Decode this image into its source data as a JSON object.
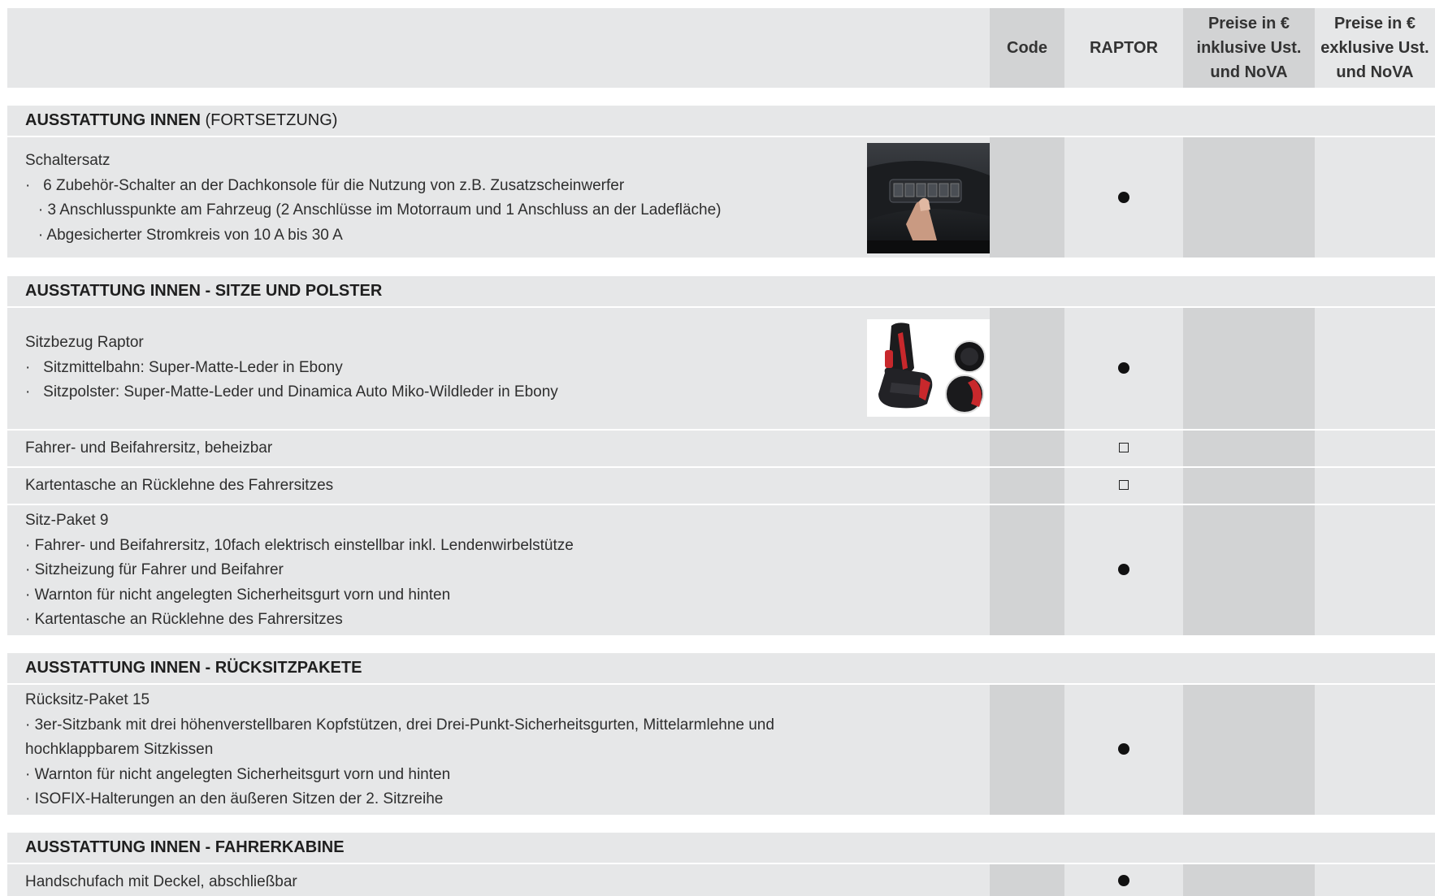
{
  "header": {
    "code": "Code",
    "raptor": "RAPTOR",
    "price_incl_lines": [
      "Preise in €",
      "inklusive Ust.",
      "und NoVA"
    ],
    "price_excl_lines": [
      "Preise in €",
      "exklusive Ust.",
      "und NoVA"
    ]
  },
  "sections": {
    "s1": {
      "title_bold": "AUSSTATTUNG INNEN",
      "title_normal": " (FORTSETZUNG)"
    },
    "s2": {
      "title_bold": "AUSSTATTUNG INNEN - SITZE UND POLSTER"
    },
    "s3": {
      "title_bold": "AUSSTATTUNG INNEN - RÜCKSITZPAKETE"
    },
    "s4": {
      "title_bold": "AUSSTATTUNG INNEN - FAHRERKABINE"
    }
  },
  "rows": {
    "schaltersatz": {
      "lines": [
        "Schaltersatz",
        "·   6 Zubehör-Schalter an der Dachkonsole für die Nutzung von z.B. Zusatzscheinwerfer",
        "   · 3 Anschlusspunkte am Fahrzeug (2 Anschlüsse im Motorraum und 1 Anschluss an der Ladefläche)",
        "   · Abgesicherter Stromkreis von 10 A bis 30 A"
      ],
      "raptor": "standard",
      "image": "overhead-switch-panel-photo"
    },
    "sitzbezug": {
      "lines": [
        "Sitzbezug Raptor",
        "·   Sitzmittelbahn: Super-Matte-Leder in Ebony",
        "·   Sitzpolster: Super-Matte-Leder und Dinamica Auto Miko-Wildleder in Ebony"
      ],
      "raptor": "standard",
      "image": "raptor-seat-photo"
    },
    "beheizbar": {
      "lines": [
        "Fahrer- und Beifahrersitz, beheizbar"
      ],
      "raptor": "optional"
    },
    "kartentasche": {
      "lines": [
        "Kartentasche an Rücklehne des Fahrersitzes"
      ],
      "raptor": "optional"
    },
    "sitzpaket": {
      "lines": [
        "Sitz-Paket 9",
        "· Fahrer- und Beifahrersitz, 10fach elektrisch einstellbar inkl. Lendenwirbelstütze",
        "· Sitzheizung für Fahrer und Beifahrer",
        "· Warnton für nicht angelegten Sicherheitsgurt vorn und hinten",
        "· Kartentasche an Rücklehne des Fahrersitzes"
      ],
      "raptor": "standard"
    },
    "ruecksitz": {
      "lines": [
        "Rücksitz-Paket 15",
        "· 3er-Sitzbank mit drei höhenverstellbaren Kopfstützen, drei Drei-Punkt-Sicherheitsgurten, Mittelarmlehne und",
        "hochklappbarem Sitzkissen",
        "· Warnton für nicht angelegten Sicherheitsgurt vorn und hinten",
        "· ISOFIX-Halterungen an den äußeren Sitzen der 2. Sitzreihe"
      ],
      "raptor": "standard"
    },
    "handschuhfach": {
      "lines": [
        "Handschufach mit Deckel, abschließbar"
      ],
      "raptor": "standard"
    }
  },
  "colors": {
    "band": "#e6e7e8",
    "column_shade": "#d2d3d4",
    "text": "#2e2e2e",
    "marker": "#111111"
  }
}
